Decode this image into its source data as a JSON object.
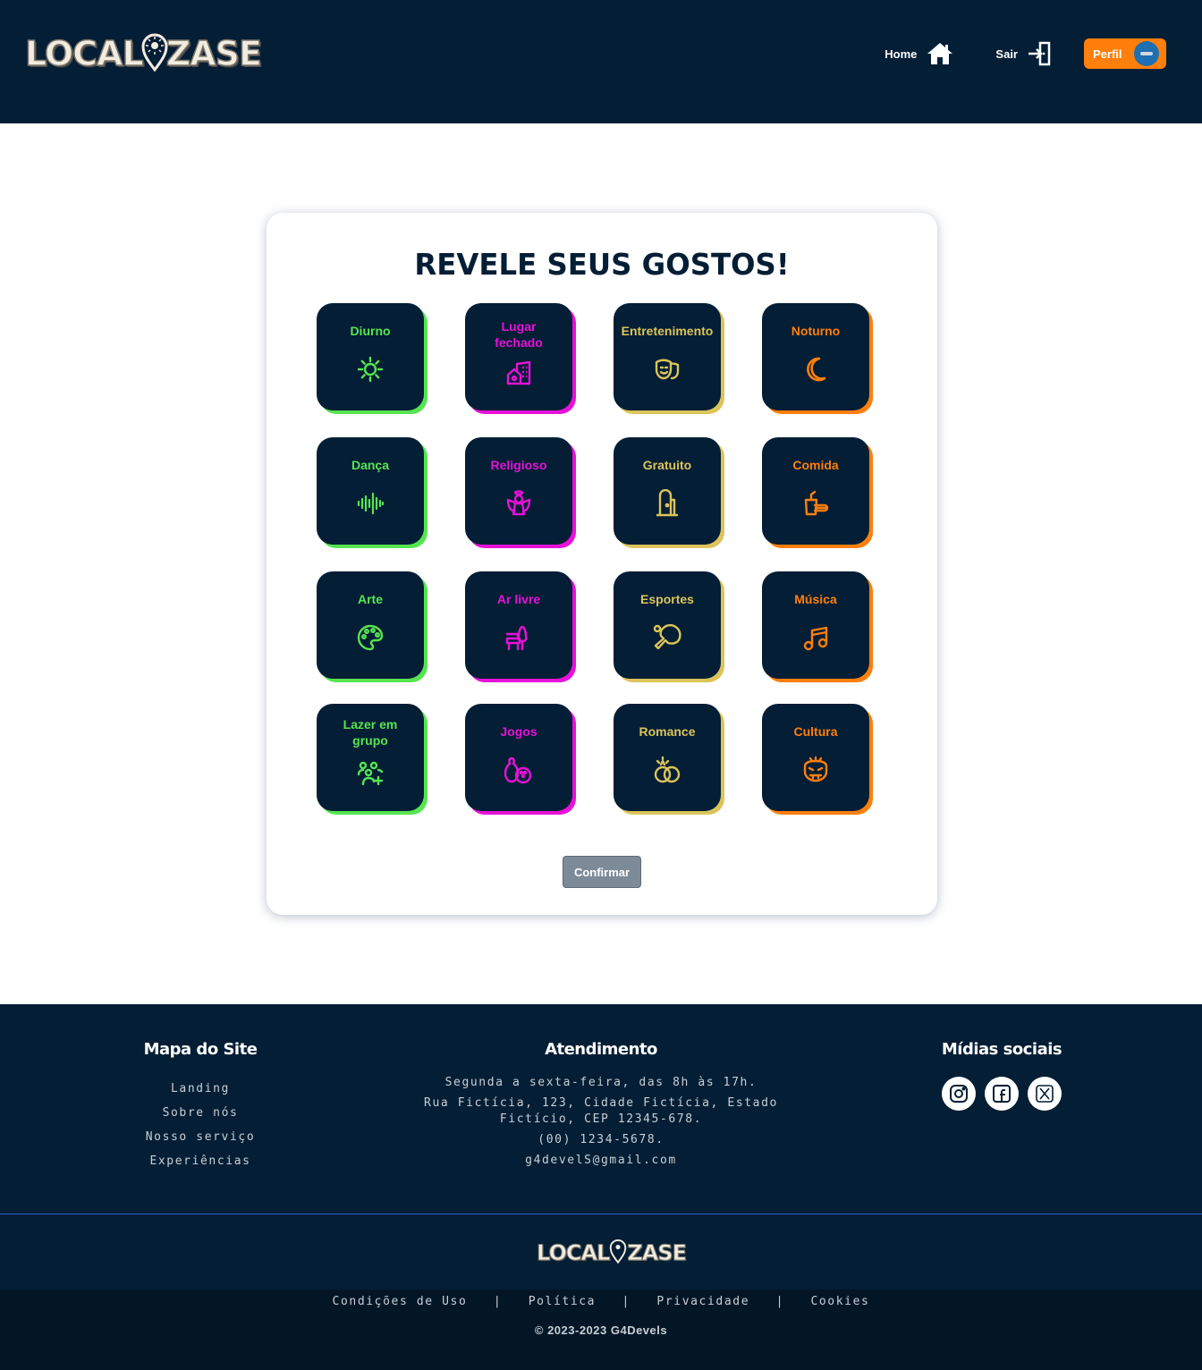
{
  "brand": {
    "logo_left": "LOCAL",
    "logo_right": "ZASE",
    "colors": {
      "navy": "#041e35",
      "orange": "#ff7f0c",
      "green": "#56e551",
      "pink": "#e711d7",
      "yellow": "#dcc45a"
    }
  },
  "header": {
    "home_label": "Home",
    "home_icon": "home-icon",
    "logout_label": "Sair",
    "logout_icon": "logout-icon",
    "profile_label": "Perfil"
  },
  "main": {
    "title": "REVELE SEUS GOSTOS!",
    "confirm_label": "Confirmar",
    "tiles": [
      {
        "label": "Diurno",
        "icon": "sun-icon",
        "color": "green"
      },
      {
        "label": "Lugar fechado",
        "icon": "building-icon",
        "color": "pink"
      },
      {
        "label": "Entretenimento",
        "icon": "theater-mask-icon",
        "color": "yellow"
      },
      {
        "label": "Noturno",
        "icon": "moon-icon",
        "color": "orange"
      },
      {
        "label": "Dança",
        "icon": "sound-wave-icon",
        "color": "green"
      },
      {
        "label": "Religioso",
        "icon": "angel-icon",
        "color": "pink"
      },
      {
        "label": "Gratuito",
        "icon": "door-icon",
        "color": "yellow"
      },
      {
        "label": "Comida",
        "icon": "food-icon",
        "color": "orange"
      },
      {
        "label": "Arte",
        "icon": "palette-icon",
        "color": "green"
      },
      {
        "label": "Ar livre",
        "icon": "bench-tree-icon",
        "color": "pink"
      },
      {
        "label": "Esportes",
        "icon": "ping-pong-icon",
        "color": "yellow"
      },
      {
        "label": "Música",
        "icon": "music-note-icon",
        "color": "orange"
      },
      {
        "label": "Lazer em grupo",
        "icon": "group-add-icon",
        "color": "green"
      },
      {
        "label": "Jogos",
        "icon": "bowling-icon",
        "color": "pink"
      },
      {
        "label": "Romance",
        "icon": "rings-icon",
        "color": "yellow"
      },
      {
        "label": "Cultura",
        "icon": "mask-icon",
        "color": "orange"
      }
    ]
  },
  "footer": {
    "sitemap_title": "Mapa do Site",
    "sitemap_links": [
      "Landing",
      "Sobre nós",
      "Nosso serviço",
      "Experiências"
    ],
    "contact_title": "Atendimento",
    "contact_lines": [
      "Segunda a sexta-feira, das 8h às 17h.",
      "Rua Fictícia, 123, Cidade Fictícia, Estado Fictício, CEP 12345-678.",
      "(00) 1234-5678.",
      "g4develS@gmail.com"
    ],
    "social_title": "Mídias sociais",
    "social_icons": [
      "instagram-icon",
      "facebook-icon",
      "x-twitter-icon"
    ],
    "legal_links": [
      "Condições de Uso",
      "Política",
      "Privacidade",
      "Cookies"
    ],
    "legal_separator": "|",
    "copyright": "© 2023-2023 G4Devels"
  }
}
